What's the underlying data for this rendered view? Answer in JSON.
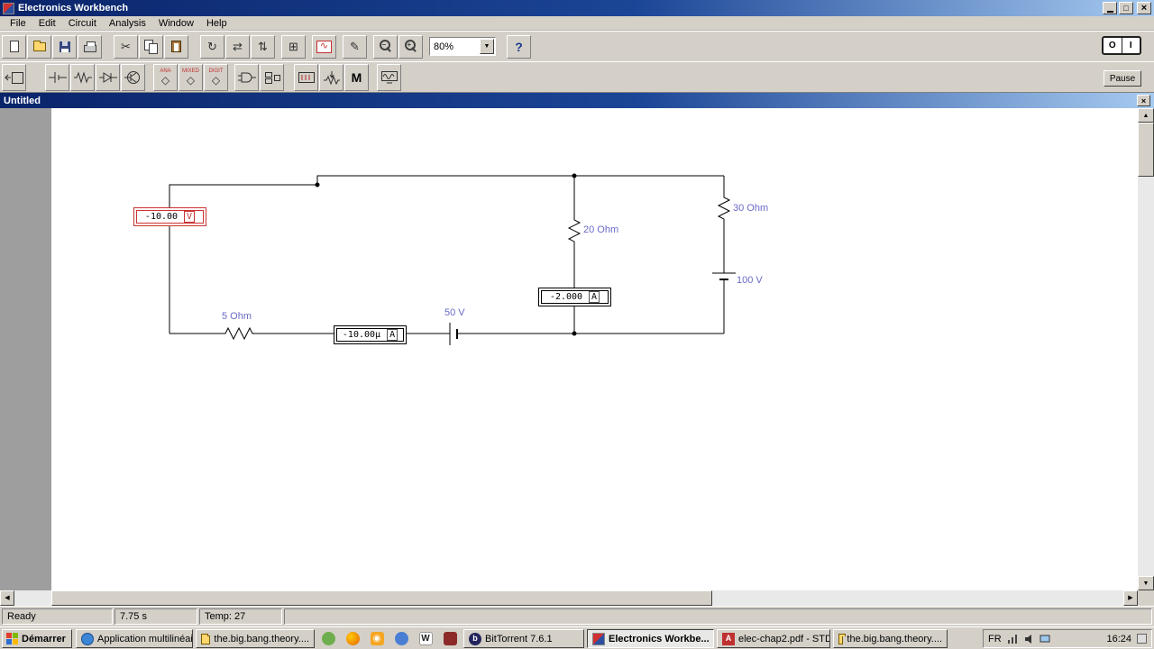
{
  "titlebar": {
    "title": "Electronics Workbench"
  },
  "menubar": {
    "items": [
      "File",
      "Edit",
      "Circuit",
      "Analysis",
      "Window",
      "Help"
    ]
  },
  "toolbar_main": {
    "zoom_value": "80%",
    "help_label": "?",
    "power_off": "O",
    "power_on": "I"
  },
  "toolbar_parts": {
    "analog_caption": "ANA",
    "mixed_caption": "MIXED",
    "digital_caption": "DIGIT",
    "misc_label": "M",
    "pause_label": "Pause"
  },
  "document_window": {
    "title": "Untitled"
  },
  "circuit": {
    "voltmeter": {
      "value": "-10.00",
      "unit": "V"
    },
    "ammeter_bottom": {
      "value": "-10.00µ",
      "unit": "A"
    },
    "ammeter_middle": {
      "value": "-2.000",
      "unit": "A"
    },
    "resistor_bottom": "5 Ohm",
    "resistor_middle": "20 Ohm",
    "resistor_right": "30 Ohm",
    "battery_bottom": "50 V",
    "battery_right": "100 V"
  },
  "statusbar": {
    "status": "Ready",
    "sim_time": "7.75 s",
    "temperature": "Temp: 27"
  },
  "taskbar": {
    "start_label": "Démarrer",
    "tasks": [
      {
        "label": "Application multilinéair..."
      },
      {
        "label": "the.big.bang.theory...."
      },
      {
        "label": "BitTorrent 7.6.1"
      },
      {
        "label": "Electronics Workbe..."
      },
      {
        "label": "elec-chap2.pdf - STD..."
      },
      {
        "label": "the.big.bang.theory...."
      }
    ],
    "tray": {
      "language": "FR",
      "clock": "16:24"
    }
  }
}
